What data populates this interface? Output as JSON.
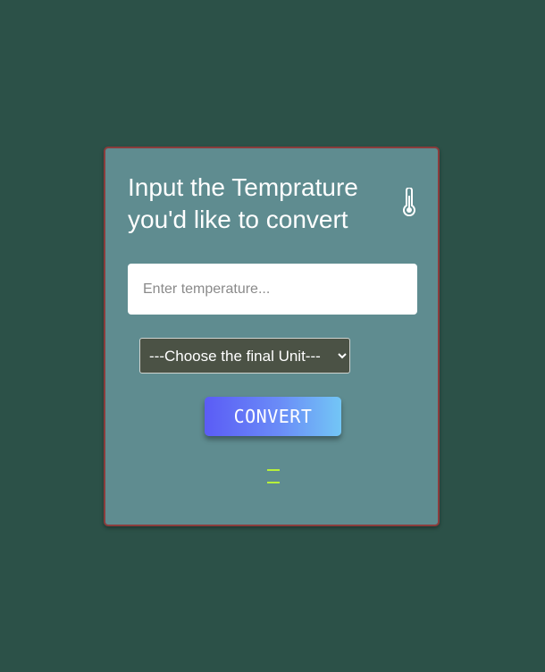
{
  "card": {
    "title": "Input the Temprature you'd like to convert",
    "icon": "thermometer-icon"
  },
  "input": {
    "placeholder": "Enter temperature...",
    "value": ""
  },
  "unit_select": {
    "selected": "---Choose the final Unit---"
  },
  "convert_button": {
    "label": "CONVERT"
  },
  "colors": {
    "page_background": "#2c5148",
    "card_background": "#5f8c90",
    "card_border": "#8a3c3c",
    "select_background": "#4b5245",
    "result_indicator": "#b7f03a",
    "button_gradient_start": "#5b5cf6",
    "button_gradient_end": "#73c6f6"
  }
}
